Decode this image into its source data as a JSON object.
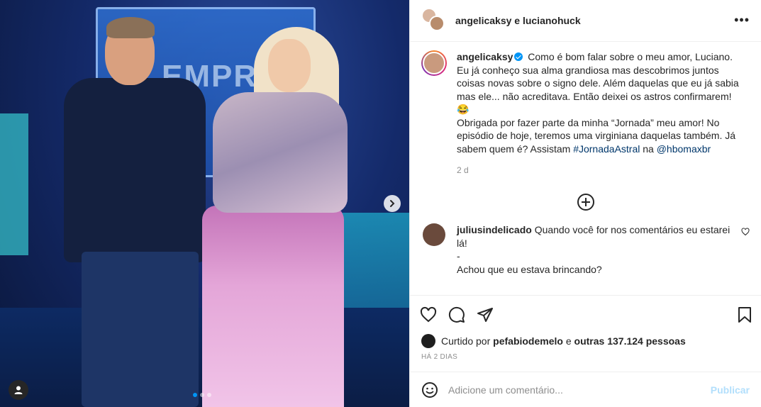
{
  "photo": {
    "sign_text": "EMPRE",
    "dots": 3,
    "active_dot": 0
  },
  "header": {
    "title": "angelicaksy e lucianohuck",
    "more": "•••"
  },
  "caption": {
    "username": "angelicaksy",
    "text_1": "Como é bom falar sobre o meu amor, Luciano. Eu já conheço sua alma grandiosa mas descobrimos juntos coisas novas sobre o signo dele. Além daquelas que eu já sabia mas ele... não acreditava. Então deixei os astros confirmarem! 😂",
    "text_2": "Obrigada por fazer parte da minha “Jornada” meu amor! No episódio de hoje, teremos uma virginiana daquelas também. Já sabem quem é? Assistam ",
    "hashtag": "#JornadaAstral",
    "text_3": " na ",
    "mention": "@hbomaxbr",
    "time_ago": "2 d"
  },
  "comment": {
    "username": "juliusindelicado",
    "line_1": "Quando você for nos comentários eu estarei lá!",
    "line_2": "-",
    "line_3": "Achou que eu estava brincando?"
  },
  "likes": {
    "prefix": "Curtido por ",
    "user": "pefabiodemelo",
    "middle": " e ",
    "others": "outras 137.124 pessoas"
  },
  "posted": "HÁ 2 DIAS",
  "add_comment": {
    "placeholder": "Adicione um comentário...",
    "publish": "Publicar"
  },
  "colors": {
    "accent": "#0095f6",
    "link": "#00376b",
    "muted": "#8e8e8e",
    "publish_disabled": "#b2dffc"
  }
}
